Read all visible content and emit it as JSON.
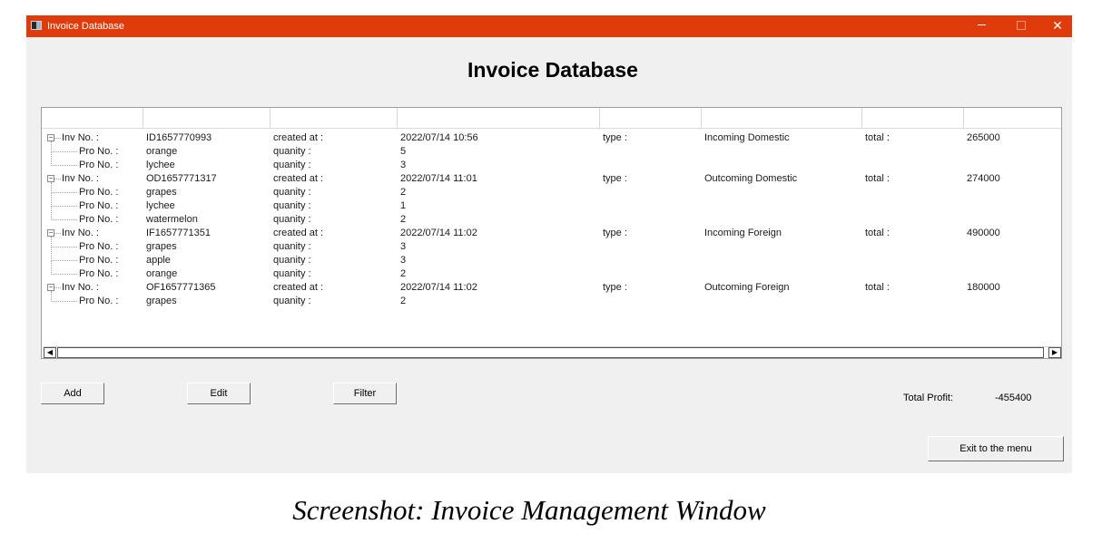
{
  "window": {
    "title": "Invoice Database",
    "heading": "Invoice Database",
    "controls": {
      "minimize_icon": "minimize-icon",
      "maximize_icon": "maximize-icon",
      "close_icon": "close-icon"
    },
    "accent_color": "#e03c0b"
  },
  "tree": {
    "invoices": [
      {
        "label": "Inv No. :",
        "id": "ID1657770993",
        "created_label": "created at :",
        "created_at": "2022/07/14 10:56",
        "type_label": "type :",
        "type": "Incoming Domestic",
        "total_label": "total :",
        "total": "265000",
        "products": [
          {
            "label": "Pro No. :",
            "name": "orange",
            "qty_label": "quanity :",
            "qty": "5"
          },
          {
            "label": "Pro No. :",
            "name": "lychee",
            "qty_label": "quanity :",
            "qty": "3"
          }
        ]
      },
      {
        "label": "Inv No. :",
        "id": "OD1657771317",
        "created_label": "created at :",
        "created_at": "2022/07/14 11:01",
        "type_label": "type :",
        "type": "Outcoming Domestic",
        "total_label": "total :",
        "total": "274000",
        "products": [
          {
            "label": "Pro No. :",
            "name": "grapes",
            "qty_label": "quanity :",
            "qty": "2"
          },
          {
            "label": "Pro No. :",
            "name": "lychee",
            "qty_label": "quanity :",
            "qty": "1"
          },
          {
            "label": "Pro No. :",
            "name": "watermelon",
            "qty_label": "quanity :",
            "qty": "2"
          }
        ]
      },
      {
        "label": "Inv No. :",
        "id": "IF1657771351",
        "created_label": "created at :",
        "created_at": "2022/07/14 11:02",
        "type_label": "type :",
        "type": "Incoming Foreign",
        "total_label": "total :",
        "total": "490000",
        "products": [
          {
            "label": "Pro No. :",
            "name": "grapes",
            "qty_label": "quanity :",
            "qty": "3"
          },
          {
            "label": "Pro No. :",
            "name": "apple",
            "qty_label": "quanity :",
            "qty": "3"
          },
          {
            "label": "Pro No. :",
            "name": "orange",
            "qty_label": "quanity :",
            "qty": "2"
          }
        ]
      },
      {
        "label": "Inv No. :",
        "id": "OF1657771365",
        "created_label": "created at :",
        "created_at": "2022/07/14 11:02",
        "type_label": "type :",
        "type": "Outcoming Foreign",
        "total_label": "total :",
        "total": "180000",
        "products": [
          {
            "label": "Pro No. :",
            "name": "grapes",
            "qty_label": "quanity :",
            "qty": "2"
          }
        ]
      }
    ]
  },
  "buttons": {
    "add": "Add",
    "edit": "Edit",
    "filter": "Filter",
    "exit": "Exit to the menu"
  },
  "profit": {
    "label": "Total Profit:",
    "value": "-455400"
  },
  "caption": "Screenshot: Invoice Management Window"
}
